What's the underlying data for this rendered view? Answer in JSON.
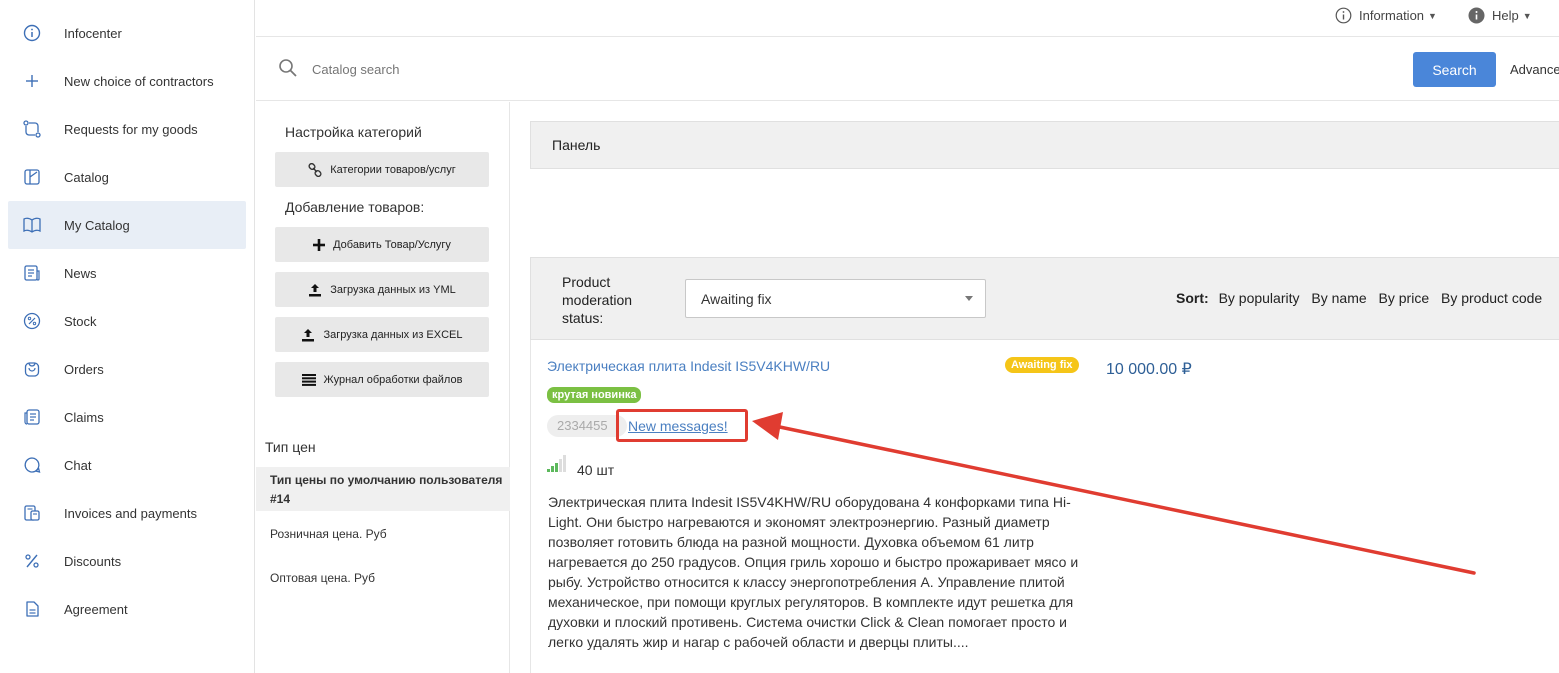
{
  "sidebar": {
    "items": [
      {
        "label": "Infocenter",
        "icon": "info-icon"
      },
      {
        "label": "New choice of contractors",
        "icon": "plus-icon"
      },
      {
        "label": "Requests for my goods",
        "icon": "exchange-icon"
      },
      {
        "label": "Catalog",
        "icon": "catalog-icon"
      },
      {
        "label": "My Catalog",
        "icon": "book-icon",
        "active": true
      },
      {
        "label": "News",
        "icon": "news-icon"
      },
      {
        "label": "Stock",
        "icon": "stock-percent-icon"
      },
      {
        "label": "Orders",
        "icon": "orders-icon"
      },
      {
        "label": "Claims",
        "icon": "claims-icon"
      },
      {
        "label": "Chat",
        "icon": "chat-icon"
      },
      {
        "label": "Invoices and payments",
        "icon": "invoice-icon"
      },
      {
        "label": "Discounts",
        "icon": "percent-icon"
      },
      {
        "label": "Agreement",
        "icon": "document-icon"
      }
    ]
  },
  "topbar": {
    "information_label": "Information",
    "help_label": "Help"
  },
  "search": {
    "placeholder": "Catalog search",
    "button_label": "Search",
    "advanced_label": "Advanced"
  },
  "left_panel": {
    "category_settings_heading": "Настройка категорий",
    "categories_button": "Категории товаров/услуг",
    "adding_products_heading": "Добавление товаров:",
    "add_product_button": "Добавить Товар/Услугу",
    "upload_yml_button": "Загрузка данных из YML",
    "upload_excel_button": "Загрузка данных из EXCEL",
    "file_log_button": "Журнал обработки файлов",
    "price_type_heading": "Тип цен",
    "price_types": [
      {
        "label": "Тип цены по умолчанию пользователя #14",
        "active": true
      },
      {
        "label": "Розничная цена. Руб",
        "active": false
      },
      {
        "label": "Оптовая цена. Руб",
        "active": false
      }
    ]
  },
  "main": {
    "panel_title": "Панель",
    "filter": {
      "label": "Product moderation status:",
      "selected_value": "Awaiting fix"
    },
    "sort": {
      "label": "Sort:",
      "options": [
        "By popularity",
        "By name",
        "By price",
        "By product code"
      ]
    },
    "product": {
      "title": "Электрическая плита Indesit IS5V4KHW/RU",
      "status_badge": "Awaiting fix",
      "price": "10 000.00 ₽",
      "tag": "крутая новинка",
      "code": "2334455",
      "new_messages_link": "New messages!",
      "stock_count": "40 шт",
      "description": "Электрическая плита Indesit IS5V4KHW/RU оборудована 4 конфорками типа Hi-Light. Они быстро нагреваются и экономят электроэнергию. Разный диаметр позволяет готовить блюда на разной мощности. Духовка объемом 61 литр нагревается до 250 градусов. Опция гриль хорошо и быстро прожаривает мясо и рыбу. Устройство относится к классу энергопотребления А. Управление плитой механическое, при помощи круглых регуляторов. В комплекте идут решетка для духовки и плоский противень. Система очистки Click & Clean помогает просто и легко удалять жир и нагар с рабочей области и дверцы плиты...."
    }
  },
  "colors": {
    "accent_blue": "#4a86d9",
    "link_blue": "#4a7fc1",
    "status_yellow": "#f5c518",
    "tag_green": "#7bc043",
    "annotation_red": "#e03c31"
  }
}
